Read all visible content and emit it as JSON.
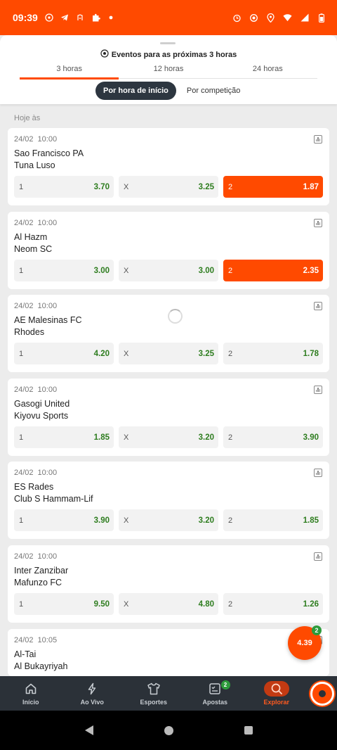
{
  "status_bar": {
    "time": "09:39",
    "left_icons": [
      "soccer-icon",
      "telegram-icon",
      "app-icon",
      "puzzle-icon",
      "dot-icon"
    ],
    "right_icons": [
      "alarm-icon",
      "location-target-icon",
      "location-pin-icon",
      "wifi-icon",
      "signal-icon",
      "battery-icon"
    ]
  },
  "panel": {
    "title": "Eventos para as próximas 3 horas",
    "tabs": [
      "3 horas",
      "12 horas",
      "24 horas"
    ],
    "active_tab": 0,
    "segments": [
      "Por hora de início",
      "Por competição"
    ],
    "active_segment": 0
  },
  "section_label": "Hoje às",
  "events": [
    {
      "date": "24/02",
      "time": "10:00",
      "home": "Sao Francisco PA",
      "away": "Tuna Luso",
      "odds": [
        {
          "label": "1",
          "value": "3.70"
        },
        {
          "label": "X",
          "value": "3.25"
        },
        {
          "label": "2",
          "value": "1.87"
        }
      ],
      "selected": 2
    },
    {
      "date": "24/02",
      "time": "10:00",
      "home": "Al Hazm",
      "away": "Neom SC",
      "odds": [
        {
          "label": "1",
          "value": "3.00"
        },
        {
          "label": "X",
          "value": "3.00"
        },
        {
          "label": "2",
          "value": "2.35"
        }
      ],
      "selected": 2
    },
    {
      "date": "24/02",
      "time": "10:00",
      "home": "AE Malesinas FC",
      "away": "Rhodes",
      "odds": [
        {
          "label": "1",
          "value": "4.20"
        },
        {
          "label": "X",
          "value": "3.25"
        },
        {
          "label": "2",
          "value": "1.78"
        }
      ],
      "selected": -1
    },
    {
      "date": "24/02",
      "time": "10:00",
      "home": "Gasogi United",
      "away": "Kiyovu Sports",
      "odds": [
        {
          "label": "1",
          "value": "1.85"
        },
        {
          "label": "X",
          "value": "3.20"
        },
        {
          "label": "2",
          "value": "3.90"
        }
      ],
      "selected": -1
    },
    {
      "date": "24/02",
      "time": "10:00",
      "home": "ES Rades",
      "away": "Club S Hammam-Lif",
      "odds": [
        {
          "label": "1",
          "value": "3.90"
        },
        {
          "label": "X",
          "value": "3.20"
        },
        {
          "label": "2",
          "value": "1.85"
        }
      ],
      "selected": -1
    },
    {
      "date": "24/02",
      "time": "10:00",
      "home": "Inter Zanzibar",
      "away": "Mafunzo FC",
      "odds": [
        {
          "label": "1",
          "value": "9.50"
        },
        {
          "label": "X",
          "value": "4.80"
        },
        {
          "label": "2",
          "value": "1.26"
        }
      ],
      "selected": -1
    },
    {
      "date": "24/02",
      "time": "10:05",
      "home": "Al-Tai",
      "away": "Al Bukayriyah",
      "odds": [],
      "selected": -1
    }
  ],
  "betslip": {
    "total_odds": "4.39",
    "count": "2"
  },
  "bottom_nav": [
    {
      "label": "Início",
      "icon": "home-icon"
    },
    {
      "label": "Ao Vivo",
      "icon": "lightning-icon"
    },
    {
      "label": "Esportes",
      "icon": "shirt-icon"
    },
    {
      "label": "Apostas",
      "icon": "betslip-icon",
      "badge": "2"
    },
    {
      "label": "Explorar",
      "icon": "search-icon",
      "active": true
    }
  ],
  "colors": {
    "brand": "#ff4a00",
    "odd_value": "#2e7d1f",
    "nav_bg": "#2b3138",
    "segment_active": "#2d3640"
  }
}
